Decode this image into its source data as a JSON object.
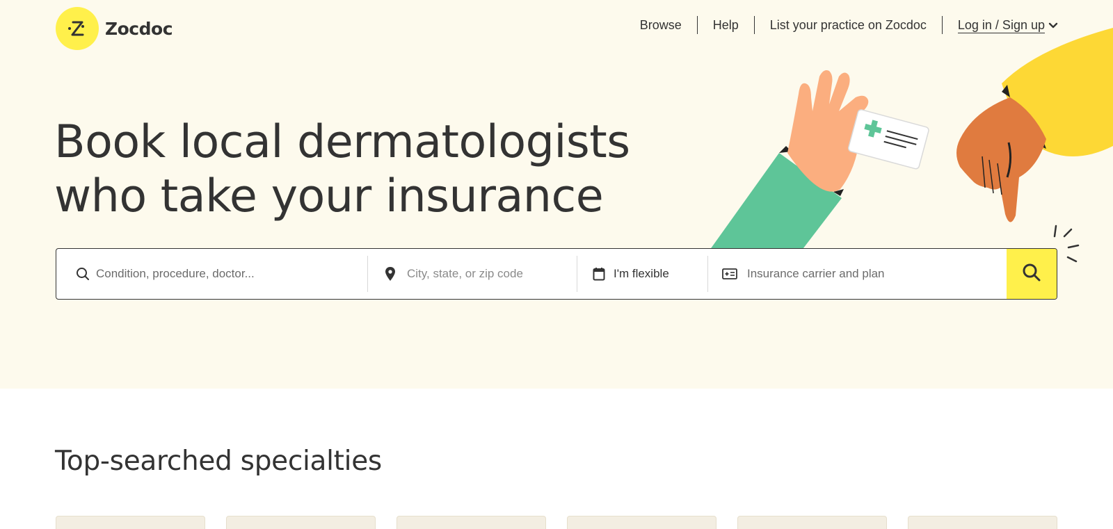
{
  "header": {
    "brand": "Zocdoc",
    "nav": {
      "browse": "Browse",
      "help": "Help",
      "list_practice": "List your practice on Zocdoc",
      "login": "Log in / Sign up"
    }
  },
  "hero": {
    "headline_line1": "Book local dermatologists",
    "headline_line2": "who take your insurance"
  },
  "search": {
    "condition_placeholder": "Condition, procedure, doctor...",
    "location_placeholder": "City, state, or zip code",
    "date_value": "I'm flexible",
    "insurance_placeholder": "Insurance carrier and plan"
  },
  "specialties": {
    "title": "Top-searched specialties",
    "cards": [
      "",
      "",
      "",
      "",
      "",
      ""
    ]
  },
  "icons": {
    "search": "search-icon",
    "location": "map-pin-icon",
    "calendar": "calendar-icon",
    "insurance": "insurance-card-icon",
    "chevron": "chevron-down-icon"
  },
  "colors": {
    "hero_bg": "#fdfaed",
    "brand_yellow": "#fff04b",
    "text": "#333333",
    "sleeve_green": "#5ec598",
    "sleeve_yellow": "#fdd835",
    "hand_light": "#fbae7f",
    "hand_dark": "#e07b3f"
  }
}
